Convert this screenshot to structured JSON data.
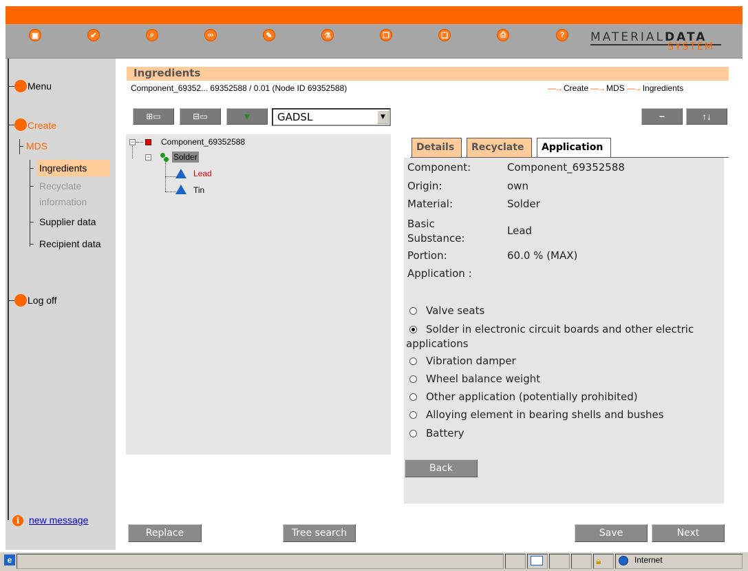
{
  "toolbar": {
    "icons": [
      {
        "name": "save-icon",
        "glyph": "▣"
      },
      {
        "name": "check-icon",
        "glyph": "✔"
      },
      {
        "name": "search-icon",
        "glyph": "⌕"
      },
      {
        "name": "glasses-icon",
        "glyph": "∞"
      },
      {
        "name": "pen-icon",
        "glyph": "✎"
      },
      {
        "name": "flask-icon",
        "glyph": "⚗"
      },
      {
        "name": "copy-icon",
        "glyph": "❐"
      },
      {
        "name": "paste-icon",
        "glyph": "❏"
      },
      {
        "name": "print-icon",
        "glyph": "⎙"
      },
      {
        "name": "help-icon",
        "glyph": "?"
      }
    ],
    "logo_line1_a": "MATERIAL",
    "logo_line1_b": "DATA",
    "logo_line2": "SYSTEM"
  },
  "sidebar": {
    "menu": "Menu",
    "create": "Create",
    "mds": "MDS",
    "ingredients": "Ingredients",
    "recyclate_1": "Recyclate",
    "recyclate_2": "information",
    "supplier": "Supplier data",
    "recipient": "Recipient data",
    "logoff": "Log off",
    "new_message": "new message"
  },
  "header": {
    "title": "Ingredients",
    "subtitle": "Component_69352... 69352588 / 0.01 (Node ID 69352588)",
    "breadcrumb": [
      "Create",
      "MDS",
      "Ingredients"
    ]
  },
  "tree_toolbar": {
    "list_select": "GADSL"
  },
  "tree": {
    "component": "Component_69352588",
    "material": "Solder",
    "substances": [
      "Lead",
      "Tin"
    ]
  },
  "tabs": [
    "Details",
    "Recyclate",
    "Application"
  ],
  "details": {
    "component_label": "Component:",
    "component_value": "Component_69352588",
    "origin_label": "Origin:",
    "origin_value": "own",
    "material_label": "Material:",
    "material_value": "Solder",
    "basic_label_1": "Basic",
    "basic_label_2": "Substance:",
    "basic_value": "Lead",
    "portion_label": "Portion:",
    "portion_value": "60.0 % (MAX)",
    "application_label": "Application :"
  },
  "applications": {
    "selected_index": 1,
    "options": [
      "Valve seats",
      "Solder in electronic circuit boards and other electric",
      "Vibration damper",
      "Wheel balance weight",
      "Other application (potentially prohibited)",
      "Alloying element in bearing shells and bushes",
      "Battery"
    ],
    "option_1_wrap": "applications"
  },
  "buttons": {
    "back": "Back",
    "replace": "Replace",
    "tree_search": "Tree search",
    "save": "Save",
    "next": "Next"
  },
  "statusbar": {
    "zone": "Internet"
  },
  "colors": {
    "accent": "#ff6600",
    "light_accent": "#ffcc99",
    "panel": "#e5e5e5",
    "substance_highlight": "#e00000"
  }
}
